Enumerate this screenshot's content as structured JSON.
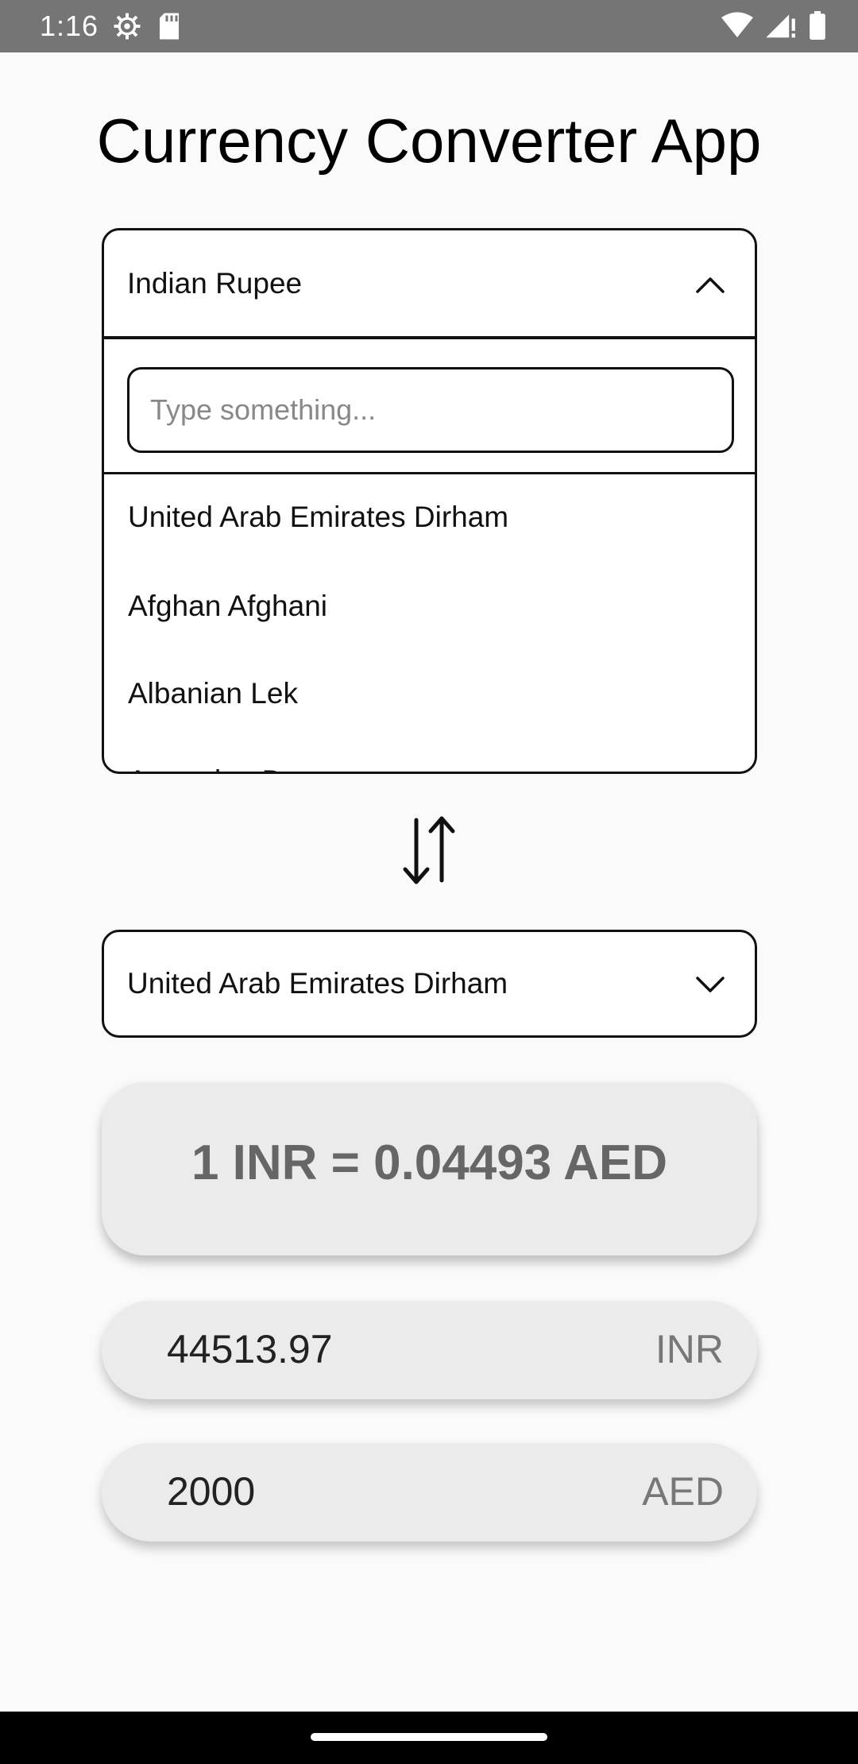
{
  "status_bar": {
    "time": "1:16",
    "left_icons": [
      "settings-icon",
      "sd-card-icon"
    ],
    "right_icons": [
      "wifi-icon",
      "signal-icon",
      "battery-icon"
    ]
  },
  "app": {
    "title": "Currency Converter App"
  },
  "from_currency": {
    "selected": "Indian Rupee",
    "expanded": true,
    "search": {
      "value": "",
      "placeholder": "Type something..."
    },
    "options": [
      "United Arab Emirates Dirham",
      "Afghan Afghani",
      "Albanian Lek",
      "Armenian Dram"
    ]
  },
  "swap": {
    "icon": "swap-vertical-icon"
  },
  "to_currency": {
    "selected": "United Arab Emirates Dirham",
    "expanded": false
  },
  "rate": {
    "text": "1 INR = 0.04493 AED"
  },
  "amounts": {
    "from_value": "44513.97",
    "from_unit": "INR",
    "to_value": "2000",
    "to_unit": "AED"
  },
  "colors": {
    "status_bar": "#757575",
    "background": "#fafafa",
    "card": "#ebebeb",
    "rate_text": "#666666",
    "border": "#111111"
  }
}
